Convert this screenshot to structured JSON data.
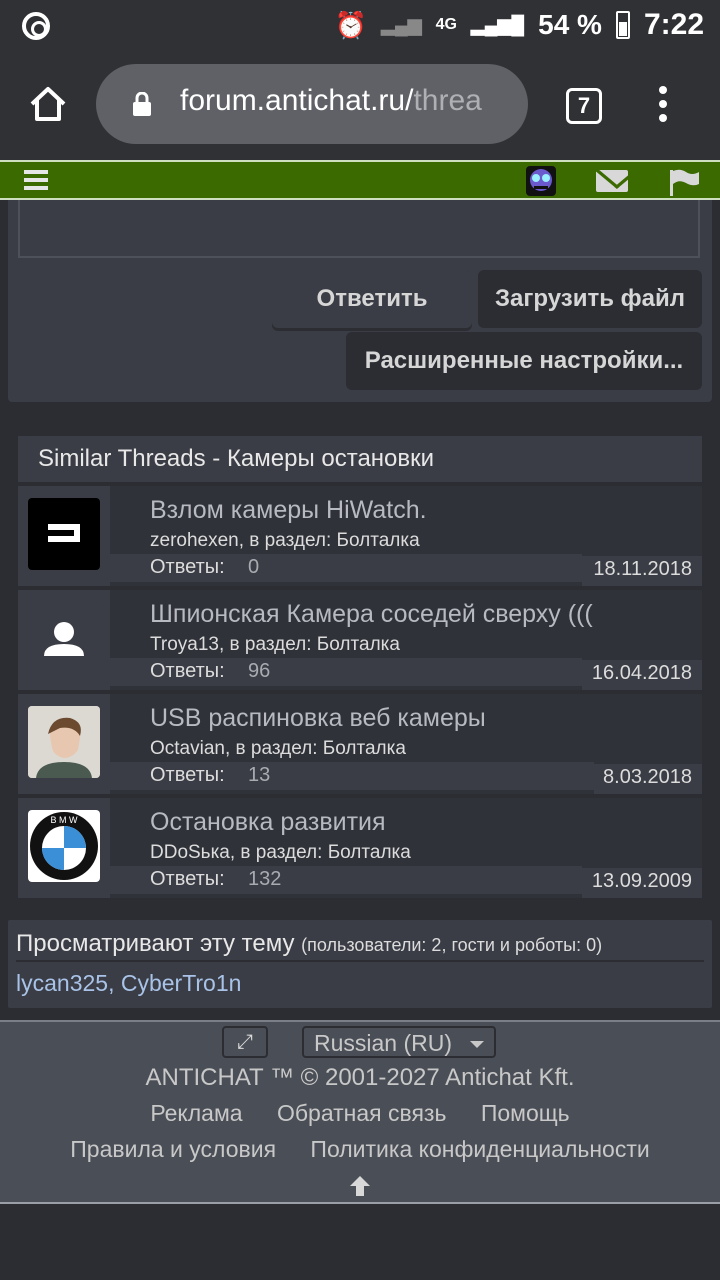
{
  "status_bar": {
    "network": "4G",
    "battery": "54 %",
    "time": "7:22"
  },
  "browser": {
    "url_main": "forum.antichat.ru/",
    "url_dim": "threa",
    "tab_count": "7"
  },
  "reply": {
    "reply_label": "Ответить",
    "upload_label": "Загрузить файл",
    "advanced_label": "Расширенные настройки..."
  },
  "similar": {
    "header": "Similar Threads - Камеры остановки",
    "answers_label": "Ответы:",
    "threads": [
      {
        "title": "Взлом камеры HiWatch.",
        "meta": "zerohexen, в раздел: Болталка",
        "answers": "0",
        "date": "18.11.2018"
      },
      {
        "title": "Шпионская Камера соседей сверху (((",
        "meta": "Troya13, в раздел: Болталка",
        "answers": "96",
        "date": "16.04.2018"
      },
      {
        "title": "USB распиновка веб камеры",
        "meta": "Octavian, в раздел: Болталка",
        "answers": "13",
        "date": "8.03.2018"
      },
      {
        "title": "Остановка развития",
        "meta": "DDoSька, в раздел: Болталка",
        "answers": "132",
        "date": "13.09.2009"
      }
    ]
  },
  "viewing": {
    "title": "Просматривают эту тему",
    "counts": "(пользователи: 2, гости и роботы: 0)",
    "users": "lycan325, CyberTro1n"
  },
  "footer": {
    "language": "Russian (RU)",
    "copyright": "ANTICHAT ™ © 2001-2027 Antichat Kft.",
    "links_row1": [
      "Реклама",
      "Обратная связь",
      "Помощь"
    ],
    "links_row2": [
      "Правила и условия",
      "Политика конфиденциальности"
    ]
  },
  "colors": {
    "nav_green": "#3a6a00",
    "panel": "#3a3d45",
    "background": "#2b2d33",
    "link_blue": "#a9c3e8"
  }
}
